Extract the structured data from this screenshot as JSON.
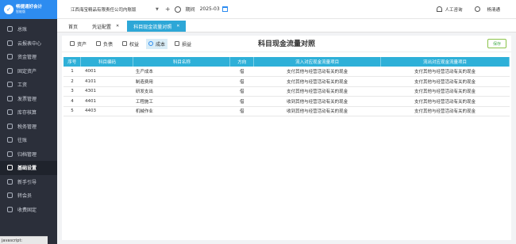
{
  "app": {
    "logo_title": "畅捷通好会计",
    "logo_subtitle": "智能版",
    "company": "江西海宝精品有限责任公司内账版",
    "period_label": "期间",
    "period_value": "2025-03",
    "support_label": "人工咨询",
    "username": "杨清通"
  },
  "sidebar": {
    "items": [
      {
        "label": "总账"
      },
      {
        "label": "云报表中心"
      },
      {
        "label": "资金管理"
      },
      {
        "label": "固定资产"
      },
      {
        "label": "工资"
      },
      {
        "label": "发票管理"
      },
      {
        "label": "库存核算"
      },
      {
        "label": "税务管理"
      },
      {
        "label": "往账"
      },
      {
        "label": "归档管理"
      },
      {
        "label": "基础设置"
      },
      {
        "label": "新手引导"
      },
      {
        "label": "转会员"
      },
      {
        "label": "收费固定"
      }
    ],
    "active_index": 10,
    "status_text": "javascript:"
  },
  "tabs": [
    {
      "label": "首页"
    },
    {
      "label": "凭证配置"
    },
    {
      "label": "科目现金流量对照"
    }
  ],
  "toolbar": {
    "buttons": [
      {
        "label": "资产"
      },
      {
        "label": "负债"
      },
      {
        "label": "权益"
      },
      {
        "label": "成本"
      },
      {
        "label": "损益"
      }
    ],
    "active_index": 3,
    "title": "科目现金流量对照",
    "save_label": "保存"
  },
  "table": {
    "headers": [
      "序号",
      "科目编码",
      "科目名称",
      "方向",
      "流入对应现金流量项目",
      "流出对应现金流量项目"
    ],
    "rows": [
      {
        "no": "1",
        "code": "4001",
        "name": "生产成本",
        "dir": "借",
        "in": "支付其他与经营活动有关的现金",
        "out": "支付其他与经营活动有关的现金"
      },
      {
        "no": "2",
        "code": "4101",
        "name": "制造费用",
        "dir": "借",
        "in": "支付其他与经营活动有关的现金",
        "out": "支付其他与经营活动有关的现金"
      },
      {
        "no": "3",
        "code": "4301",
        "name": "研发支出",
        "dir": "借",
        "in": "支付其他与经营活动有关的现金",
        "out": "支付其他与经营活动有关的现金"
      },
      {
        "no": "4",
        "code": "4401",
        "name": "工程施工",
        "dir": "借",
        "in": "收到其他与经营活动有关的现金",
        "out": "支付其他与经营活动有关的现金"
      },
      {
        "no": "5",
        "code": "4403",
        "name": "机械作业",
        "dir": "借",
        "in": "收到其他与经营活动有关的现金",
        "out": "支付其他与经营活动有关的现金"
      }
    ]
  },
  "colors": {
    "sidebar_bg": "#2b2f3a",
    "brand_blue": "#2d8cf0",
    "table_header": "#2eb0d8",
    "active_tab": "#2da7d7"
  }
}
